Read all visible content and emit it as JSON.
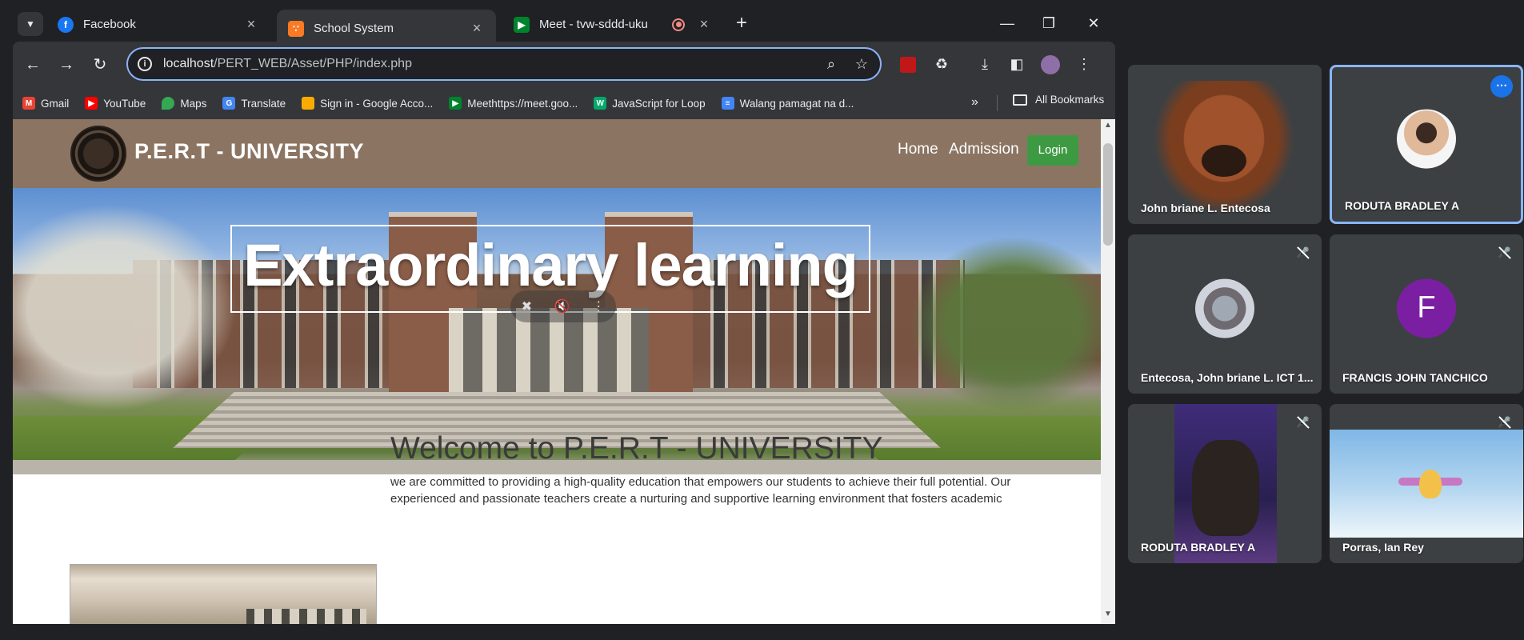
{
  "browser": {
    "tabs": [
      {
        "title": "Facebook",
        "favicon": "facebook-icon",
        "color": "#1877f2",
        "active": false
      },
      {
        "title": "School System",
        "favicon": "xampp-icon",
        "color": "#fb7a24",
        "active": true
      },
      {
        "title": "Meet - tvw-sddd-uku",
        "favicon": "meet-icon",
        "color": "#00832d",
        "active": false,
        "recording": true
      }
    ],
    "url": {
      "host": "localhost",
      "path": "/PERT_WEB/Asset/PHP/index.php"
    },
    "bookmarks": [
      {
        "label": "Gmail",
        "icon": "gmail-icon",
        "color": "#ea4335"
      },
      {
        "label": "YouTube",
        "icon": "youtube-icon",
        "color": "#ff0000"
      },
      {
        "label": "Maps",
        "icon": "maps-icon",
        "color": "#34a853"
      },
      {
        "label": "Translate",
        "icon": "translate-icon",
        "color": "#4285f4"
      },
      {
        "label": "Sign in - Google Acco...",
        "icon": "classroom-icon",
        "color": "#f9ab00"
      },
      {
        "label": "Meethttps://meet.goo...",
        "icon": "meet-icon",
        "color": "#00832d"
      },
      {
        "label": "JavaScript for Loop",
        "icon": "w3schools-icon",
        "color": "#04aa6d"
      },
      {
        "label": "Walang pamagat na d...",
        "icon": "docs-icon",
        "color": "#4285f4"
      }
    ],
    "all_bookmarks_label": "All Bookmarks"
  },
  "site": {
    "title": "P.E.R.T - UNIVERSITY",
    "nav": {
      "home": "Home",
      "admission": "Admission",
      "login": "Login"
    },
    "hero_heading": "Extraordinary learning",
    "welcome_title": "Welcome to P.E.R.T - UNIVERSITY",
    "welcome_text": "we are committed to providing a high-quality education that empowers our students to achieve their full potential. Our experienced and passionate teachers create a nurturing and supportive learning environment that fosters academic"
  },
  "meet": {
    "participants": [
      {
        "name": "John briane L. Entecosa",
        "video": "dog-filter",
        "muted": false,
        "speaking": false
      },
      {
        "name": "RODUTA BRADLEY A",
        "video": "avatar-photo",
        "muted": false,
        "speaking": true
      },
      {
        "name": "Entecosa, John briane L. ICT 1...",
        "video": "avatar-photo",
        "muted": true,
        "speaking": false
      },
      {
        "name": "FRANCIS JOHN TANCHICO",
        "video": "avatar-letter",
        "avatar_letter": "F",
        "avatar_color": "#7b1fa2",
        "muted": true,
        "speaking": false
      },
      {
        "name": "RODUTA BRADLEY A",
        "video": "cat-filter",
        "muted": true,
        "speaking": false
      },
      {
        "name": "Porras, Ian Rey",
        "video": "sky-scene",
        "muted": true,
        "speaking": false
      }
    ]
  }
}
